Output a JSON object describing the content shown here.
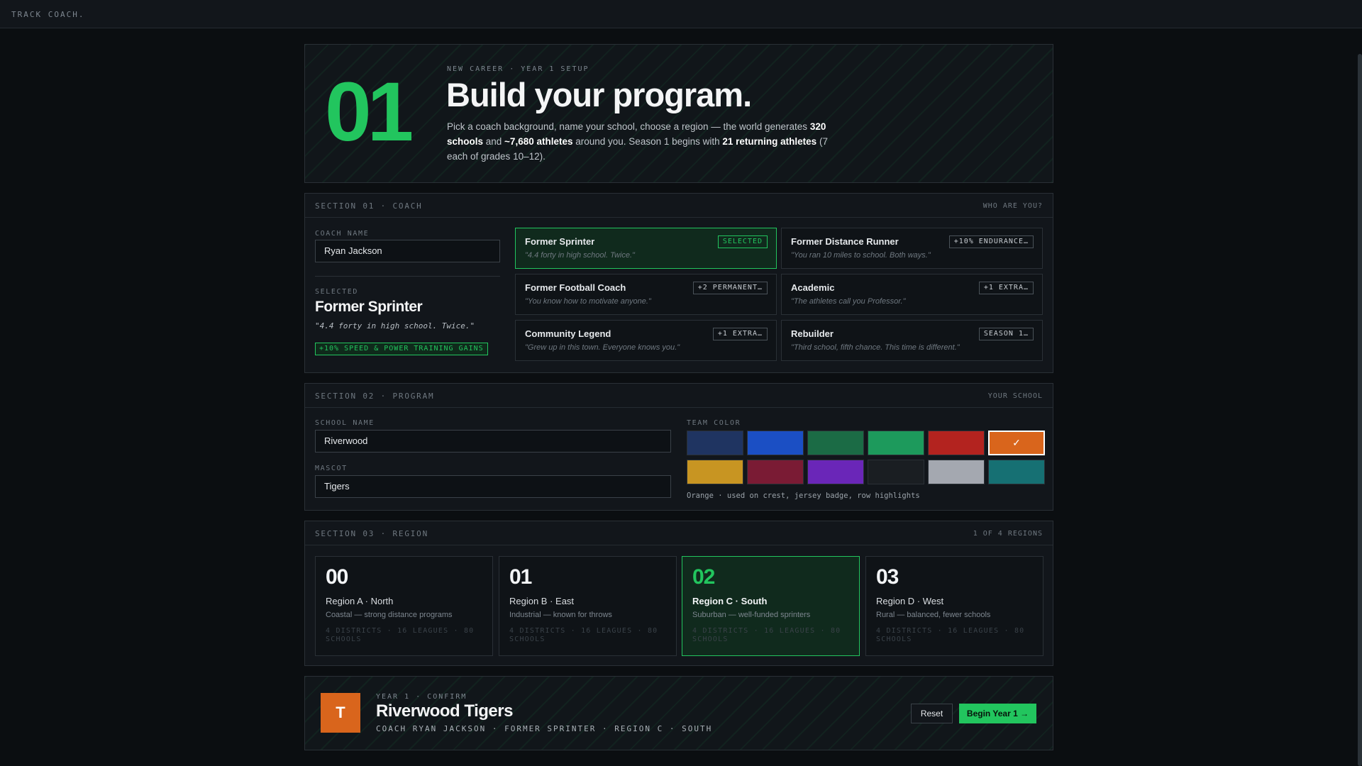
{
  "app": {
    "brand": "TRACK COACH."
  },
  "hero": {
    "number": "01",
    "eyebrow": "NEW CAREER · YEAR 1 SETUP",
    "title": "Build your program.",
    "desc": {
      "t1": "Pick a coach background, name your school, choose a region — the world generates",
      "b1": "320 schools",
      "t2": " and ",
      "b2": "~7,680 athletes",
      "t3": " around you. Season 1 begins with ",
      "b3": "21 returning athletes",
      "t4": " (7 each of grades 10–12)."
    }
  },
  "coach": {
    "section_label": "SECTION 01 · COACH",
    "section_right": "WHO ARE YOU?",
    "name_label": "COACH NAME",
    "name_value": "Ryan Jackson",
    "selected_label": "SELECTED",
    "selected_name": "Former Sprinter",
    "selected_quote": "\"4.4 forty in high school. Twice.\"",
    "selected_perk": "+10% SPEED & POWER TRAINING GAINS",
    "cards": [
      {
        "name": "Former Sprinter",
        "badge": "SELECTED",
        "quote": "\"4.4 forty in high school. Twice.\""
      },
      {
        "name": "Former Distance Runner",
        "badge": "+10% ENDURANCE…",
        "quote": "\"You ran 10 miles to school. Both ways.\""
      },
      {
        "name": "Former Football Coach",
        "badge": "+2 PERMANENT…",
        "quote": "\"You know how to motivate anyone.\""
      },
      {
        "name": "Academic",
        "badge": "+1 EXTRA…",
        "quote": "\"The athletes call you Professor.\""
      },
      {
        "name": "Community Legend",
        "badge": "+1 EXTRA…",
        "quote": "\"Grew up in this town. Everyone knows you.\""
      },
      {
        "name": "Rebuilder",
        "badge": "SEASON 1…",
        "quote": "\"Third school, fifth chance. This time is different.\""
      }
    ]
  },
  "program": {
    "section_label": "SECTION 02 · PROGRAM",
    "section_right": "YOUR SCHOOL",
    "school_label": "SCHOOL NAME",
    "school_value": "Riverwood",
    "mascot_label": "MASCOT",
    "mascot_value": "Tigers",
    "color_label": "TEAM COLOR",
    "color_note": "Orange · used on crest, jersey badge, row highlights",
    "selected_mark": "✓",
    "colors": [
      "#1f3461",
      "#1b4fc4",
      "#1b6b45",
      "#1d9a5c",
      "#b3231f",
      "#d9651c",
      "#c89522",
      "#7a1b34",
      "#6a26b8",
      "#1a1e22",
      "#a4a8b0",
      "#167073"
    ]
  },
  "region": {
    "section_label": "SECTION 03 · REGION",
    "section_right": "1 OF 4 REGIONS",
    "cards": [
      {
        "num": "00",
        "name": "Region A · North",
        "desc": "Coastal — strong distance programs",
        "meta": "4 DISTRICTS · 16 LEAGUES · 80 SCHOOLS"
      },
      {
        "num": "01",
        "name": "Region B · East",
        "desc": "Industrial — known for throws",
        "meta": "4 DISTRICTS · 16 LEAGUES · 80 SCHOOLS"
      },
      {
        "num": "02",
        "name": "Region C · South",
        "desc": "Suburban — well-funded sprinters",
        "meta": "4 DISTRICTS · 16 LEAGUES · 80 SCHOOLS"
      },
      {
        "num": "03",
        "name": "Region D · West",
        "desc": "Rural — balanced, fewer schools",
        "meta": "4 DISTRICTS · 16 LEAGUES · 80 SCHOOLS"
      }
    ]
  },
  "confirm": {
    "crest_letter": "T",
    "eyebrow": "YEAR 1 · CONFIRM",
    "team": "Riverwood Tigers",
    "summary": "COACH RYAN JACKSON · FORMER SPRINTER · REGION C · SOUTH",
    "reset": "Reset",
    "begin": "Begin Year 1 →"
  },
  "colors": {
    "accent": "#22c55e",
    "team": "#d9651c",
    "bg": "#0b0e11",
    "panel": "#12161b"
  }
}
